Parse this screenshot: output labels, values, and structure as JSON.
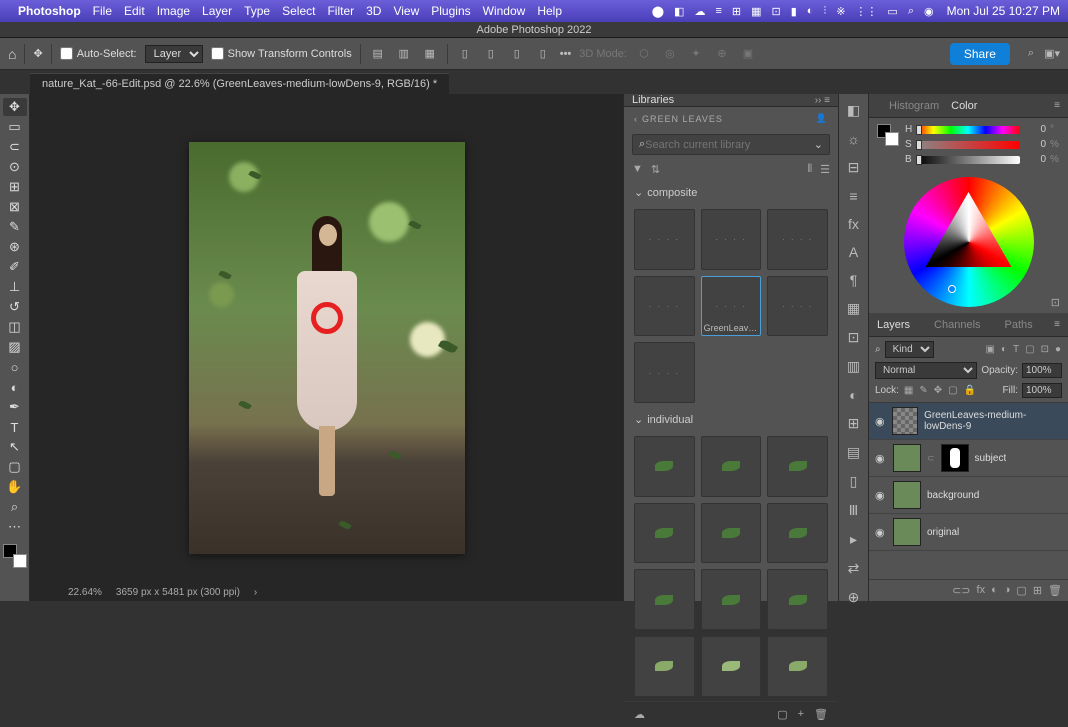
{
  "macMenu": {
    "appName": "Photoshop",
    "items": [
      "File",
      "Edit",
      "Image",
      "Layer",
      "Type",
      "Select",
      "Filter",
      "3D",
      "View",
      "Plugins",
      "Window",
      "Help"
    ],
    "datetime": "Mon Jul 25  10:27 PM"
  },
  "titleBar": "Adobe Photoshop 2022",
  "optionsBar": {
    "autoSelect": "Auto-Select:",
    "layerDropdown": "Layer",
    "showTransform": "Show Transform Controls",
    "mode3d": "3D Mode:",
    "share": "Share"
  },
  "docTab": "nature_Kat_-66-Edit.psd @ 22.6% (GreenLeaves-medium-lowDens-9, RGB/16) *",
  "libraries": {
    "tabLabel": "Libraries",
    "breadcrumb": "GREEN LEAVES",
    "searchPlaceholder": "Search current library",
    "groupComposite": "composite",
    "groupIndividual": "individual",
    "selectedLabel": "GreenLeaves-..."
  },
  "rightTabs": {
    "histogram": "Histogram",
    "color": "Color",
    "layers": "Layers",
    "channels": "Channels",
    "paths": "Paths"
  },
  "colorSliders": {
    "h": {
      "label": "H",
      "value": "0",
      "unit": "°"
    },
    "s": {
      "label": "S",
      "value": "0",
      "unit": "%"
    },
    "b": {
      "label": "B",
      "value": "0",
      "unit": "%"
    }
  },
  "layersPanel": {
    "kind": "Kind",
    "blend": "Normal",
    "opacityLabel": "Opacity:",
    "opacity": "100%",
    "lockLabel": "Lock:",
    "fillLabel": "Fill:",
    "fill": "100%",
    "layers": [
      {
        "name": "GreenLeaves-medium-lowDens-9",
        "selected": true,
        "checker": true
      },
      {
        "name": "subject",
        "mask": true
      },
      {
        "name": "background"
      },
      {
        "name": "original"
      }
    ]
  },
  "statusBar": {
    "zoom": "22.64%",
    "dims": "3659 px x 5481 px (300 ppi)"
  }
}
